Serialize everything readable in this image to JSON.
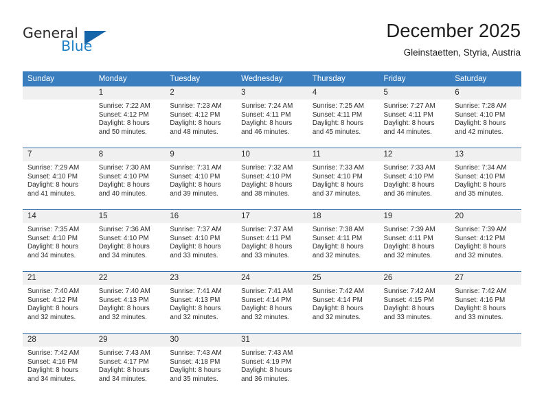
{
  "brand": {
    "name_part1": "General",
    "name_part2": "Blue",
    "logo_icon": "triangle-mark"
  },
  "header": {
    "title": "December 2025",
    "subtitle": "Gleinstaetten, Styria, Austria"
  },
  "colors": {
    "header_blue": "#3a7ebf",
    "row_divider_blue": "#2c6ca8",
    "daynum_band": "#f0f0f0",
    "brand_blue": "#1f7fc4",
    "text": "#2b2b2b"
  },
  "weekday_headers": [
    "Sunday",
    "Monday",
    "Tuesday",
    "Wednesday",
    "Thursday",
    "Friday",
    "Saturday"
  ],
  "weeks": [
    [
      {
        "day": "",
        "lines": []
      },
      {
        "day": "1",
        "lines": [
          "Sunrise: 7:22 AM",
          "Sunset: 4:12 PM",
          "Daylight: 8 hours",
          "and 50 minutes."
        ]
      },
      {
        "day": "2",
        "lines": [
          "Sunrise: 7:23 AM",
          "Sunset: 4:12 PM",
          "Daylight: 8 hours",
          "and 48 minutes."
        ]
      },
      {
        "day": "3",
        "lines": [
          "Sunrise: 7:24 AM",
          "Sunset: 4:11 PM",
          "Daylight: 8 hours",
          "and 46 minutes."
        ]
      },
      {
        "day": "4",
        "lines": [
          "Sunrise: 7:25 AM",
          "Sunset: 4:11 PM",
          "Daylight: 8 hours",
          "and 45 minutes."
        ]
      },
      {
        "day": "5",
        "lines": [
          "Sunrise: 7:27 AM",
          "Sunset: 4:11 PM",
          "Daylight: 8 hours",
          "and 44 minutes."
        ]
      },
      {
        "day": "6",
        "lines": [
          "Sunrise: 7:28 AM",
          "Sunset: 4:10 PM",
          "Daylight: 8 hours",
          "and 42 minutes."
        ]
      }
    ],
    [
      {
        "day": "7",
        "lines": [
          "Sunrise: 7:29 AM",
          "Sunset: 4:10 PM",
          "Daylight: 8 hours",
          "and 41 minutes."
        ]
      },
      {
        "day": "8",
        "lines": [
          "Sunrise: 7:30 AM",
          "Sunset: 4:10 PM",
          "Daylight: 8 hours",
          "and 40 minutes."
        ]
      },
      {
        "day": "9",
        "lines": [
          "Sunrise: 7:31 AM",
          "Sunset: 4:10 PM",
          "Daylight: 8 hours",
          "and 39 minutes."
        ]
      },
      {
        "day": "10",
        "lines": [
          "Sunrise: 7:32 AM",
          "Sunset: 4:10 PM",
          "Daylight: 8 hours",
          "and 38 minutes."
        ]
      },
      {
        "day": "11",
        "lines": [
          "Sunrise: 7:33 AM",
          "Sunset: 4:10 PM",
          "Daylight: 8 hours",
          "and 37 minutes."
        ]
      },
      {
        "day": "12",
        "lines": [
          "Sunrise: 7:33 AM",
          "Sunset: 4:10 PM",
          "Daylight: 8 hours",
          "and 36 minutes."
        ]
      },
      {
        "day": "13",
        "lines": [
          "Sunrise: 7:34 AM",
          "Sunset: 4:10 PM",
          "Daylight: 8 hours",
          "and 35 minutes."
        ]
      }
    ],
    [
      {
        "day": "14",
        "lines": [
          "Sunrise: 7:35 AM",
          "Sunset: 4:10 PM",
          "Daylight: 8 hours",
          "and 34 minutes."
        ]
      },
      {
        "day": "15",
        "lines": [
          "Sunrise: 7:36 AM",
          "Sunset: 4:10 PM",
          "Daylight: 8 hours",
          "and 34 minutes."
        ]
      },
      {
        "day": "16",
        "lines": [
          "Sunrise: 7:37 AM",
          "Sunset: 4:10 PM",
          "Daylight: 8 hours",
          "and 33 minutes."
        ]
      },
      {
        "day": "17",
        "lines": [
          "Sunrise: 7:37 AM",
          "Sunset: 4:11 PM",
          "Daylight: 8 hours",
          "and 33 minutes."
        ]
      },
      {
        "day": "18",
        "lines": [
          "Sunrise: 7:38 AM",
          "Sunset: 4:11 PM",
          "Daylight: 8 hours",
          "and 32 minutes."
        ]
      },
      {
        "day": "19",
        "lines": [
          "Sunrise: 7:39 AM",
          "Sunset: 4:11 PM",
          "Daylight: 8 hours",
          "and 32 minutes."
        ]
      },
      {
        "day": "20",
        "lines": [
          "Sunrise: 7:39 AM",
          "Sunset: 4:12 PM",
          "Daylight: 8 hours",
          "and 32 minutes."
        ]
      }
    ],
    [
      {
        "day": "21",
        "lines": [
          "Sunrise: 7:40 AM",
          "Sunset: 4:12 PM",
          "Daylight: 8 hours",
          "and 32 minutes."
        ]
      },
      {
        "day": "22",
        "lines": [
          "Sunrise: 7:40 AM",
          "Sunset: 4:13 PM",
          "Daylight: 8 hours",
          "and 32 minutes."
        ]
      },
      {
        "day": "23",
        "lines": [
          "Sunrise: 7:41 AM",
          "Sunset: 4:13 PM",
          "Daylight: 8 hours",
          "and 32 minutes."
        ]
      },
      {
        "day": "24",
        "lines": [
          "Sunrise: 7:41 AM",
          "Sunset: 4:14 PM",
          "Daylight: 8 hours",
          "and 32 minutes."
        ]
      },
      {
        "day": "25",
        "lines": [
          "Sunrise: 7:42 AM",
          "Sunset: 4:14 PM",
          "Daylight: 8 hours",
          "and 32 minutes."
        ]
      },
      {
        "day": "26",
        "lines": [
          "Sunrise: 7:42 AM",
          "Sunset: 4:15 PM",
          "Daylight: 8 hours",
          "and 33 minutes."
        ]
      },
      {
        "day": "27",
        "lines": [
          "Sunrise: 7:42 AM",
          "Sunset: 4:16 PM",
          "Daylight: 8 hours",
          "and 33 minutes."
        ]
      }
    ],
    [
      {
        "day": "28",
        "lines": [
          "Sunrise: 7:42 AM",
          "Sunset: 4:16 PM",
          "Daylight: 8 hours",
          "and 34 minutes."
        ]
      },
      {
        "day": "29",
        "lines": [
          "Sunrise: 7:43 AM",
          "Sunset: 4:17 PM",
          "Daylight: 8 hours",
          "and 34 minutes."
        ]
      },
      {
        "day": "30",
        "lines": [
          "Sunrise: 7:43 AM",
          "Sunset: 4:18 PM",
          "Daylight: 8 hours",
          "and 35 minutes."
        ]
      },
      {
        "day": "31",
        "lines": [
          "Sunrise: 7:43 AM",
          "Sunset: 4:19 PM",
          "Daylight: 8 hours",
          "and 36 minutes."
        ]
      },
      {
        "day": "",
        "lines": []
      },
      {
        "day": "",
        "lines": []
      },
      {
        "day": "",
        "lines": []
      }
    ]
  ]
}
